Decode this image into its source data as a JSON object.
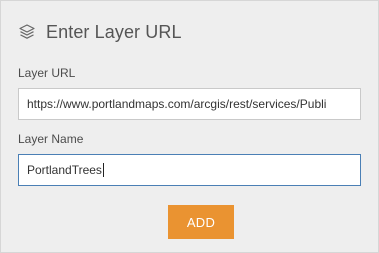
{
  "dialog": {
    "title": "Enter Layer URL",
    "icon": "layers-icon"
  },
  "layer_url": {
    "label": "Layer URL",
    "value": "https://www.portlandmaps.com/arcgis/rest/services/Publi"
  },
  "layer_name": {
    "label": "Layer Name",
    "value": "PortlandTrees"
  },
  "actions": {
    "add_label": "ADD"
  },
  "colors": {
    "panel_background": "#eeeeee",
    "add_button": "#ea9331",
    "focused_border": "#4a7fb5"
  }
}
